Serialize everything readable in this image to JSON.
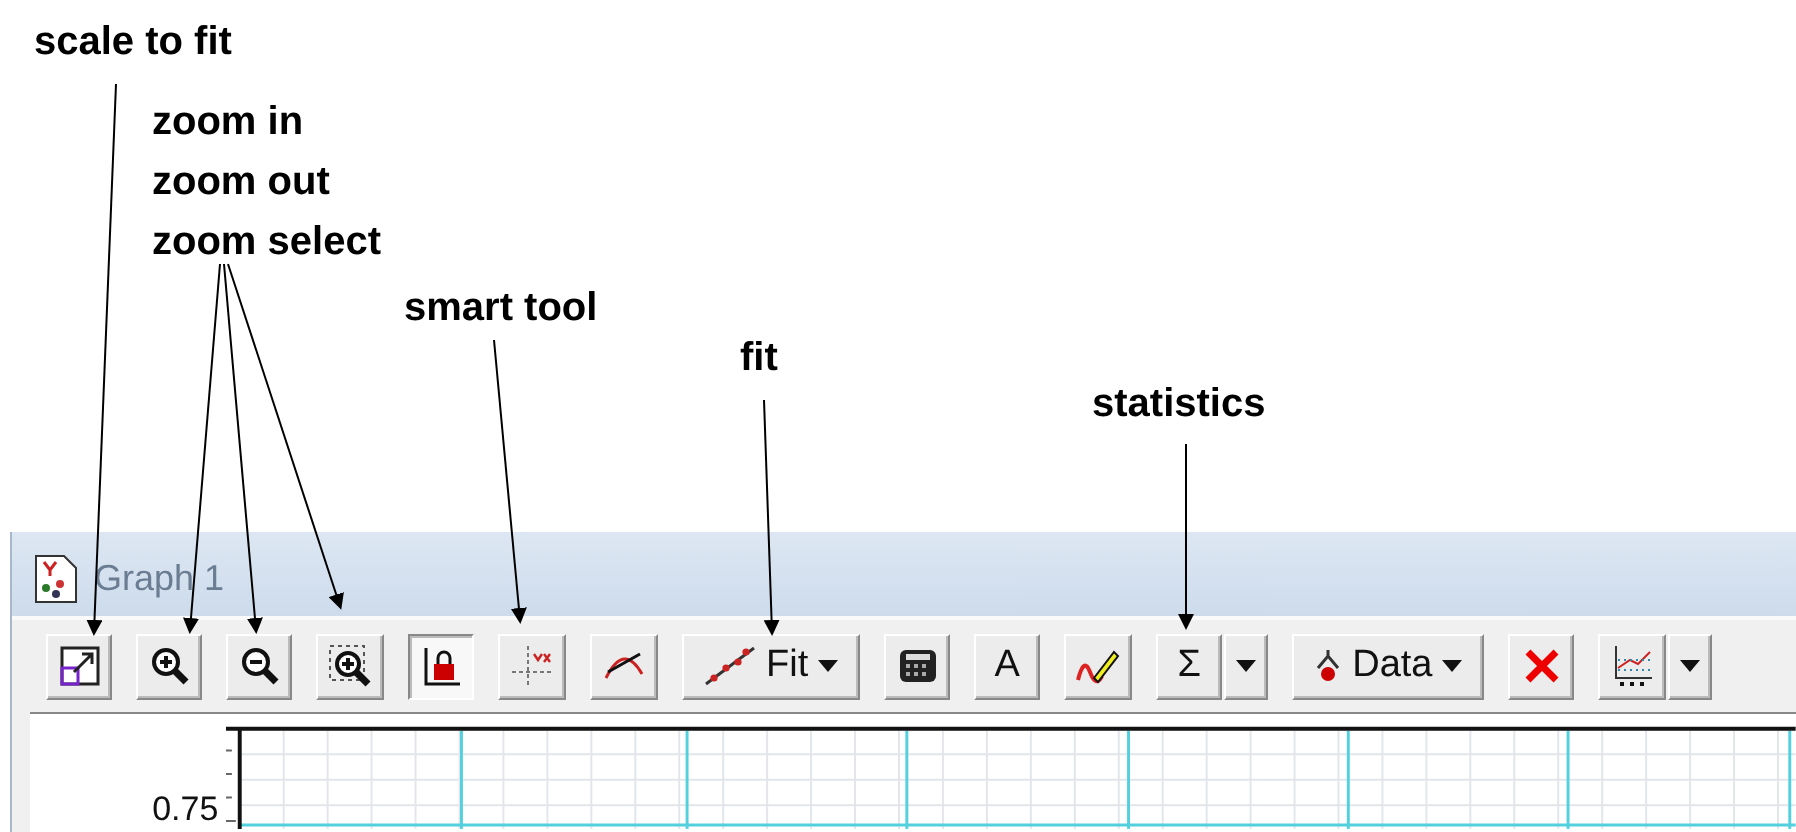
{
  "annotations": [
    {
      "label": "scale to fit"
    },
    {
      "label": "zoom in"
    },
    {
      "label": "zoom out"
    },
    {
      "label": "zoom select"
    },
    {
      "label": "smart tool"
    },
    {
      "label": "fit"
    },
    {
      "label": "statistics"
    }
  ],
  "window": {
    "title": "Graph 1"
  },
  "toolbar": [
    {
      "kind": "scale",
      "pressed": false
    },
    {
      "kind": "zoom-in",
      "pressed": false
    },
    {
      "kind": "zoom-out",
      "pressed": false
    },
    {
      "kind": "zoom-select",
      "pressed": false
    },
    {
      "kind": "lock",
      "pressed": true
    },
    {
      "kind": "smart",
      "pressed": false
    },
    {
      "kind": "curve",
      "pressed": false
    },
    {
      "kind": "fit",
      "label": "Fit",
      "pressed": false
    },
    {
      "kind": "calculator",
      "pressed": false
    },
    {
      "kind": "text",
      "label": "A",
      "pressed": false
    },
    {
      "kind": "pencil",
      "pressed": false
    },
    {
      "kind": "sigma",
      "label": "Σ",
      "pressed": false
    },
    {
      "kind": "dropdown",
      "pressed": false
    },
    {
      "kind": "data",
      "label": "Data",
      "pressed": false
    },
    {
      "kind": "delete",
      "pressed": false
    },
    {
      "kind": "graph-options",
      "pressed": false
    },
    {
      "kind": "dropdown",
      "pressed": false
    }
  ],
  "graph": {
    "y_tick": "0.75"
  }
}
